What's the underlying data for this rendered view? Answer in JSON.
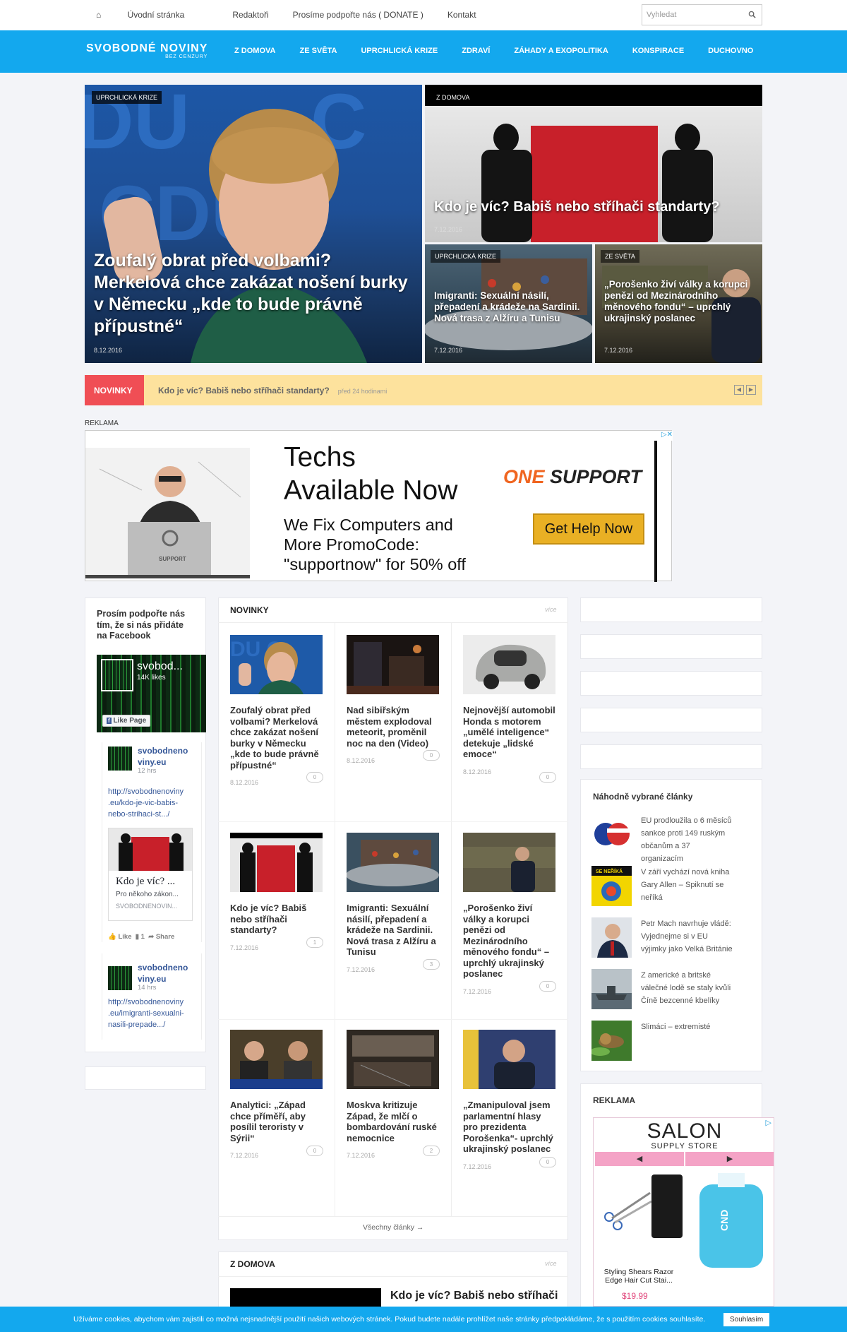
{
  "topnav": {
    "home": "Úvodní stránka",
    "editors": "Redaktoři",
    "donate": "Prosíme podpořte nás ( DONATE )",
    "contact": "Kontakt"
  },
  "search": {
    "placeholder": "Vyhledat"
  },
  "logo": {
    "title": "SVOBODNÉ NOVINY",
    "subtitle": "BEZ CENZURY"
  },
  "mainnav": [
    "Z DOMOVA",
    "ZE SVĚTA",
    "UPRCHLICKÁ KRIZE",
    "ZDRAVÍ",
    "ZÁHADY A EXOPOLITIKA",
    "KONSPIRACE",
    "DUCHOVNO"
  ],
  "hero": {
    "main": {
      "tag": "UPRCHLICKÁ KRIZE",
      "title": "Zoufalý obrat před volbami? Merkelová chce zakázat nošení burky v Německu „kde to bude právně přípustné“",
      "date": "8.12.2016"
    },
    "topright": {
      "tag": "Z DOMOVA",
      "title": "Kdo je víc? Babiš nebo stříhači standarty?",
      "date": "7.12.2016"
    },
    "bl": {
      "tag": "UPRCHLICKÁ KRIZE",
      "title": "Imigranti: Sexuální násilí, přepadení a krádeže na Sardinii. Nová trasa z Alžíru a Tunisu",
      "date": "7.12.2016"
    },
    "br": {
      "tag": "ZE SVĚTA",
      "title": "„Porošenko živí války a korupci penězi od Mezinárodního měnového fondu“ – uprchlý ukrajinský poslanec",
      "date": "7.12.2016"
    }
  },
  "ticker": {
    "label": "NOVINKY",
    "text": "Kdo je víc? Babiš nebo stříhači standarty?",
    "time": "před 24 hodinami"
  },
  "ad": {
    "label": "REKLAMA",
    "headline1": "Techs",
    "headline2": "Available Now",
    "body1": "We Fix Computers and",
    "body2": "More PromoCode:",
    "body3": "\"supportnow\" for 50% off",
    "brand_prefix": "ONE",
    "brand": "SUPPORT",
    "cta": "Get Help Now",
    "laptop": "SUPPORT"
  },
  "fb": {
    "title": "Prosím podpořte nás tím, že si nás přidáte na Facebook",
    "page_name": "svobod...",
    "likes": "14K likes",
    "like_btn": "Like Page",
    "post1": {
      "name1": "svobodneno",
      "name2": "viny.eu",
      "time": "12 hrs",
      "l1": "http://svobodnenoviny",
      "l2": ".eu/kdo-je-vic-babis-",
      "l3": "nebo-strihaci-st.../",
      "card_title": "Kdo je víc? ...",
      "card_desc": "Pro někoho zákon...",
      "card_src": "SVOBODNENOVIN...",
      "like": "Like",
      "comments": "1",
      "share": "Share"
    },
    "post2": {
      "name1": "svobodneno",
      "name2": "viny.eu",
      "time": "14 hrs",
      "l1": "http://svobodnenoviny",
      "l2": ".eu/imigranti-sexualni-",
      "l3": "nasili-prepade.../"
    }
  },
  "novinky": {
    "title": "NOVINKY",
    "more": "více",
    "all": "Všechny články →",
    "items": [
      {
        "title": "Zoufalý obrat před volbami? Merkelová chce zakázat nošení burky v Německu „kde to bude právně přípustné“",
        "date": "8.12.2016",
        "comments": "0"
      },
      {
        "title": "Nad sibiřským městem explodoval meteorit, proměnil noc na den (Video)",
        "date": "8.12.2016",
        "comments": "0"
      },
      {
        "title": "Nejnovější automobil Honda s motorem „umělé inteligence“ detekuje „lidské emoce“",
        "date": "8.12.2016",
        "comments": "0"
      },
      {
        "title": "Kdo je víc? Babiš nebo stříhači standarty?",
        "date": "7.12.2016",
        "comments": "1"
      },
      {
        "title": "Imigranti: Sexuální násilí, přepadení a krádeže na Sardinii. Nová trasa z Alžíru a Tunisu",
        "date": "7.12.2016",
        "comments": "3"
      },
      {
        "title": "„Porošenko živí války a korupci penězi od Mezinárodního měnového fondu“ – uprchlý ukrajinský poslanec",
        "date": "7.12.2016",
        "comments": "0"
      },
      {
        "title": "Analytici: „Západ chce příměří, aby posílil teroristy v Sýrii“",
        "date": "7.12.2016",
        "comments": "0"
      },
      {
        "title": "Moskva kritizuje Západ, že mlčí o bombardování ruské nemocnice",
        "date": "7.12.2016",
        "comments": "2"
      },
      {
        "title": "„Zmanipuloval jsem parlamentní hlasy pro prezidenta Porošenka“- uprchlý ukrajinský poslanec",
        "date": "7.12.2016",
        "comments": "0"
      }
    ]
  },
  "zdomova": {
    "title": "Z DOMOVA",
    "more": "více",
    "first": "Kdo je víc? Babiš nebo stříhači"
  },
  "random": {
    "title": "Náhodně vybrané články",
    "items": [
      "EU prodloužila o 6 měsíců sankce proti 149 ruským občanům a 37 organizacím",
      "V září vychází nová kniha Gary Allen – Spiknutí se neříká",
      "Petr Mach navrhuje vládě: Vyjednejme si v EU výjimky jako Velká Británie",
      "Z americké a britské válečné lodě se staly kvůli Číně bezcenné kbelíky",
      "Slimáci – extremisté"
    ],
    "book_label": "SE NEŘÍKÁ"
  },
  "rightad": {
    "title": "REKLAMA",
    "brand": "SALON",
    "sub": "SUPPLY STORE",
    "prod": "Styling Shears Razor Edge Hair Cut Stai...",
    "price": "$19.99",
    "bottle": "CND"
  },
  "cookie": {
    "text": "Užíváme cookies, abychom vám zajistili co možná nejsnadnější použití našich webových stránek. Pokud budete nadále prohlížet naše stránky předpokládáme, že s použitím cookies souhlasíte.",
    "btn": "Souhlasím"
  }
}
